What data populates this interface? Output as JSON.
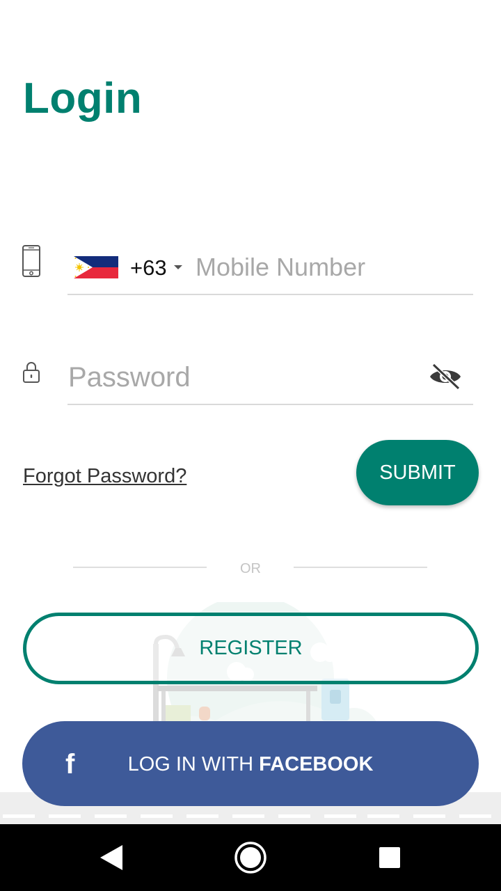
{
  "theme": {
    "accent": "#00806F",
    "facebook_blue": "#3E5A99"
  },
  "header": {
    "title": "Login"
  },
  "phone": {
    "icon": "smartphone-icon",
    "flag": "philippines-flag",
    "dial_code": "+63",
    "placeholder": "Mobile Number",
    "value": ""
  },
  "password": {
    "icon": "lock-icon",
    "placeholder": "Password",
    "value": "",
    "toggle_icon": "eye-off-icon"
  },
  "actions": {
    "forgot_label": "Forgot Password?",
    "submit_label": "SUBMIT",
    "or_label": "OR",
    "register_label": "REGISTER",
    "facebook_prefix": "LOG IN WITH ",
    "facebook_bold": "FACEBOOK",
    "facebook_icon": "facebook-f-icon"
  },
  "nav": {
    "back_icon": "back-triangle-icon",
    "home_icon": "home-circle-icon",
    "recents_icon": "recents-square-icon"
  }
}
